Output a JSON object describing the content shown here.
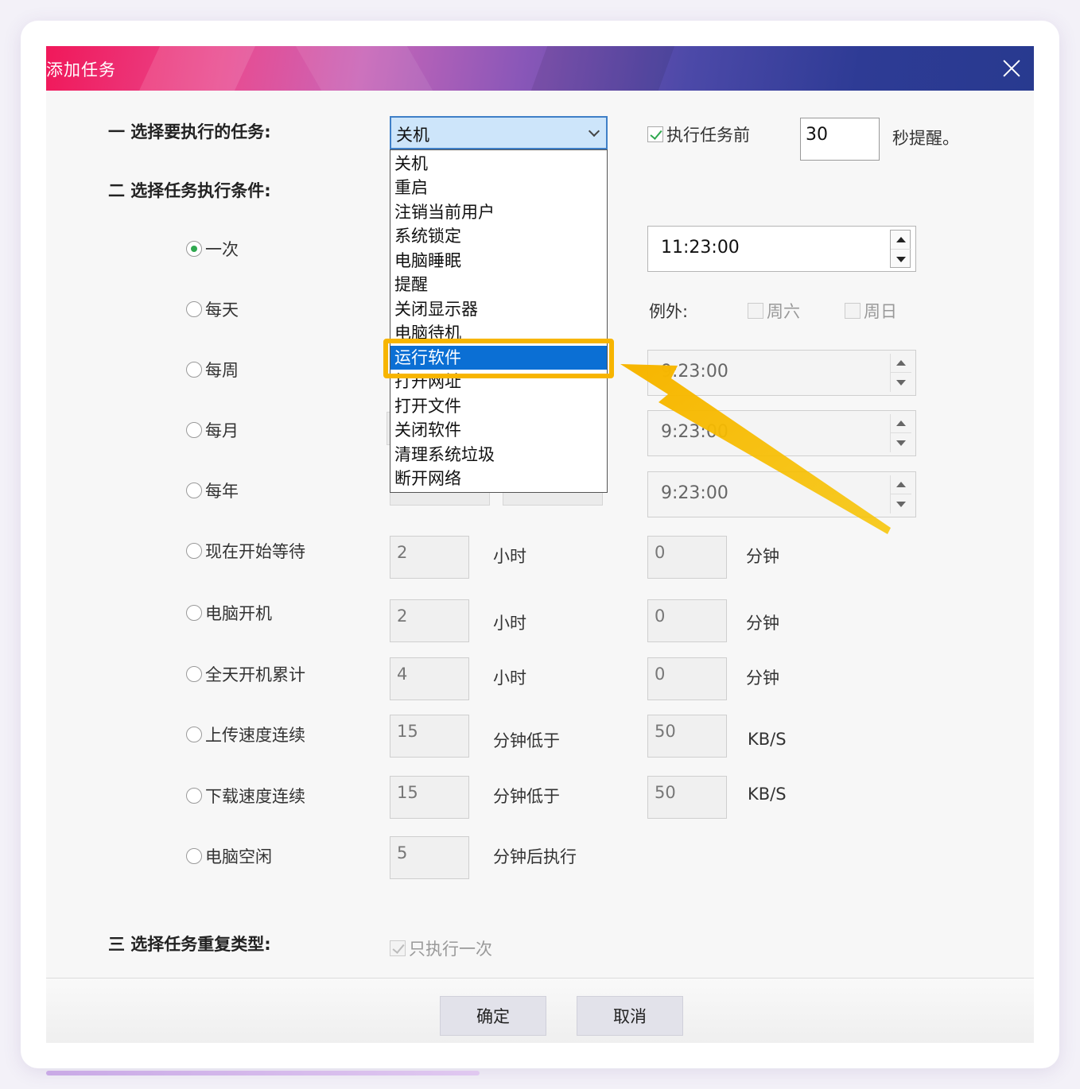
{
  "dialog": {
    "title": "添加任务"
  },
  "section1": {
    "label": "一 选择要执行的任务:",
    "selected_task": "关机",
    "remind_label": "执行任务前",
    "remind_seconds": "30",
    "remind_suffix": "秒提醒。"
  },
  "dropdown": {
    "items": [
      "关机",
      "重启",
      "注销当前用户",
      "系统锁定",
      "电脑睡眠",
      "提醒",
      "关闭显示器",
      "电脑待机",
      "运行软件",
      "打开网址",
      "打开文件",
      "关闭软件",
      "清理系统垃圾",
      "断开网络"
    ],
    "highlighted_index": 8
  },
  "section2": {
    "label": "二 选择任务执行条件:",
    "options": {
      "once": "一次",
      "daily": "每天",
      "weekly": "每周",
      "monthly": "每月",
      "yearly": "每年",
      "wait": "现在开始等待",
      "boot": "电脑开机",
      "uptime": "全天开机累计",
      "upload": "上传速度连续",
      "download": "下载速度连续",
      "idle": "电脑空闲"
    },
    "selected": "once",
    "once_time": "11:23:00",
    "exception_label": "例外:",
    "saturday": "周六",
    "sunday": "周日",
    "weekly_time": "9:23:00",
    "monthly_time": "9:23:00",
    "yearly_time": "9:23:00",
    "wait_hours": "2",
    "wait_minutes": "0",
    "boot_hours": "2",
    "boot_minutes": "0",
    "uptime_hours": "4",
    "uptime_minutes": "0",
    "upload_minutes": "15",
    "upload_kbs": "50",
    "download_minutes": "15",
    "download_kbs": "50",
    "idle_minutes": "5",
    "hours_unit": "小时",
    "minutes_unit": "分钟",
    "below_label": "分钟低于",
    "kbs_unit": "KB/S",
    "after_label": "分钟后执行"
  },
  "section3": {
    "label": "三 选择任务重复类型:",
    "once_only": "只执行一次"
  },
  "footer": {
    "ok_label": "确定",
    "cancel_label": "取消"
  },
  "colors": {
    "highlight": "#f7b500",
    "selection": "#0b6fd4",
    "radio_on": "#2fa84f"
  }
}
